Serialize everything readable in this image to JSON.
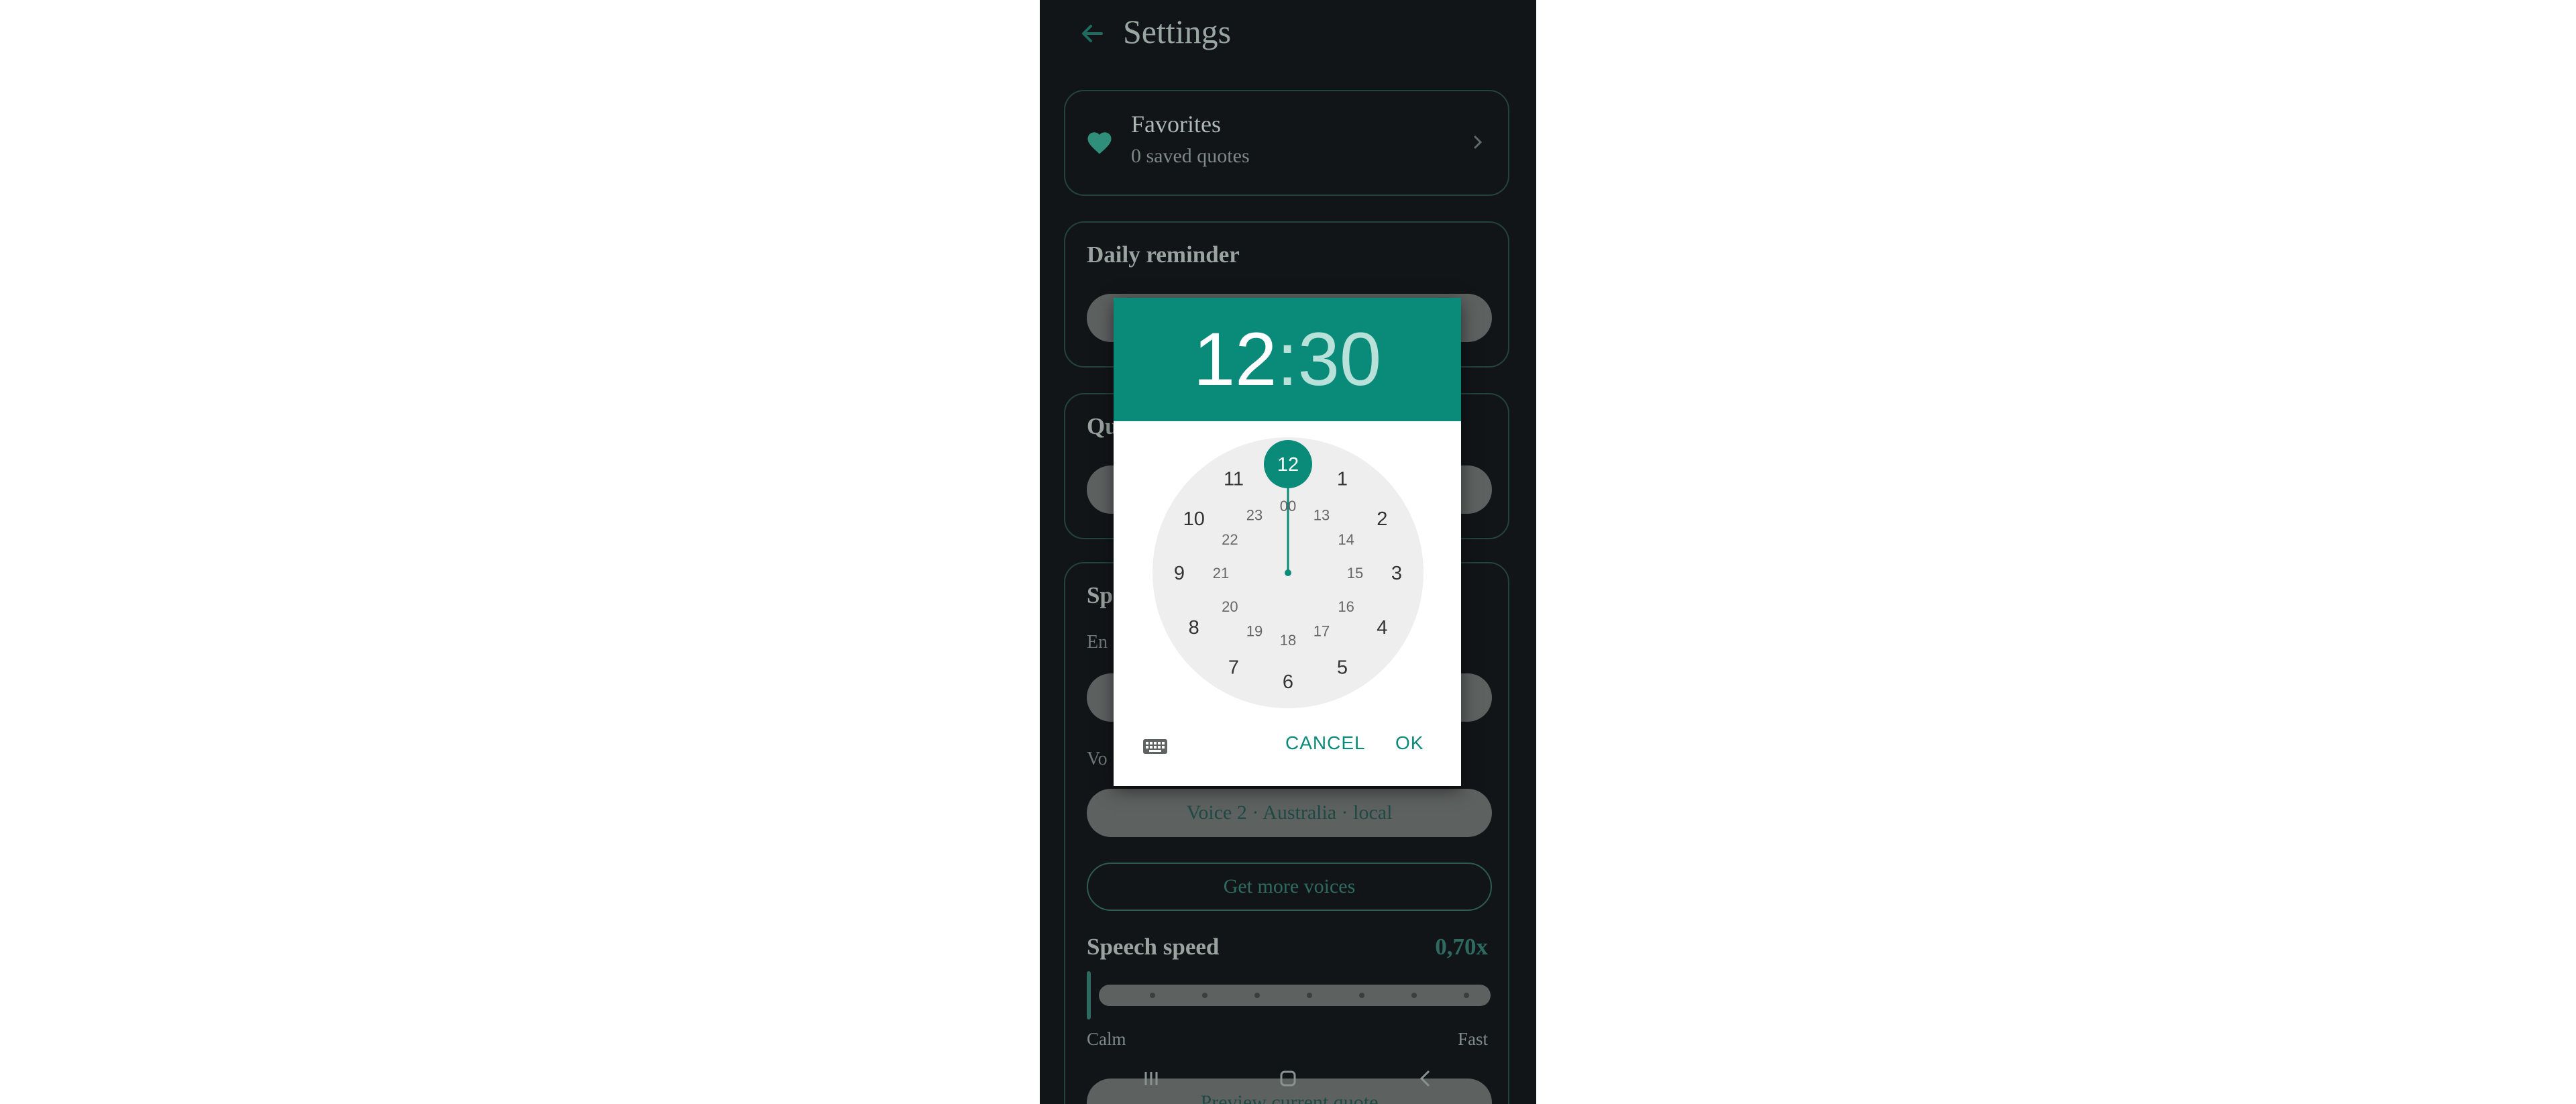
{
  "header": {
    "title": "Settings"
  },
  "favorites": {
    "title": "Favorites",
    "subtitle": "0 saved quotes"
  },
  "daily_reminder": {
    "title": "Daily reminder"
  },
  "quotes_section": {
    "title": "Qu"
  },
  "speech": {
    "title": "Sp",
    "engine_label": "En",
    "voice_label": "Vo",
    "voice_value": "Voice 2 · Australia · local",
    "more_voices": "Get more voices",
    "speed_label": "Speech speed",
    "speed_value": "0,70x",
    "calm": "Calm",
    "fast": "Fast",
    "preview": "Preview current quote"
  },
  "dialog": {
    "hour": "12",
    "separator": ":",
    "minute": "30",
    "selected_hour": "12",
    "outer_hours": [
      "12",
      "1",
      "2",
      "3",
      "4",
      "5",
      "6",
      "7",
      "8",
      "9",
      "10",
      "11"
    ],
    "inner_hours": [
      "00",
      "13",
      "14",
      "15",
      "16",
      "17",
      "18",
      "19",
      "20",
      "21",
      "22",
      "23"
    ],
    "cancel": "CANCEL",
    "ok": "OK"
  },
  "colors": {
    "accent": "#0a8a78",
    "background": "#121518",
    "pill": "#5d6160"
  }
}
